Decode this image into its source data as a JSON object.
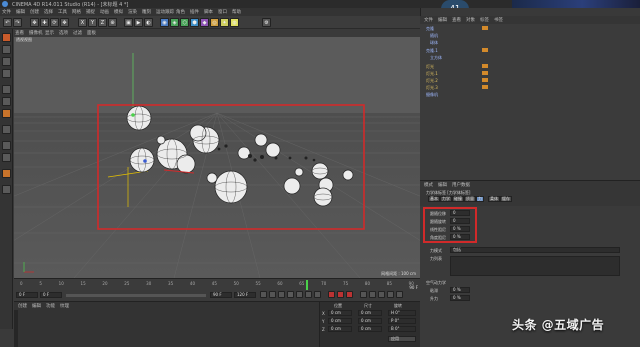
{
  "window": {
    "title": "CINEMA 4D R14.011 Studio (R14) - [未标题 4 *]",
    "top_badge": "41"
  },
  "menu": {
    "items": [
      "文件",
      "编辑",
      "创建",
      "选择",
      "工具",
      "网格",
      "捕捉",
      "动画",
      "模拟",
      "渲染",
      "雕刻",
      "运动跟踪",
      "角色",
      "插件",
      "脚本",
      "窗口",
      "帮助"
    ]
  },
  "toolbar": {
    "buttons": [
      "↶",
      "↷",
      "✥",
      "✚",
      "⟳",
      "✥",
      "X",
      "Y",
      "Z",
      "⊕",
      "▣",
      "▶",
      "◐",
      "◉",
      "◈",
      "⬡",
      "⬢",
      "◆",
      "◎",
      "✦",
      "◍",
      "⚙"
    ]
  },
  "viewport": {
    "menu_items": [
      "查看",
      "摄像机",
      "显示",
      "选项",
      "过滤",
      "面板"
    ],
    "tab_label": "透视视图",
    "grid_label": "网格间距 : 100 cm",
    "accent_red": "#d12a2a",
    "bg": "#5b5b5b"
  },
  "timeline": {
    "ticks": [
      "0",
      "5",
      "10",
      "15",
      "20",
      "25",
      "30",
      "35",
      "40",
      "45",
      "50",
      "55",
      "60",
      "65",
      "70",
      "75",
      "80",
      "85",
      "90"
    ],
    "end_frame": "90 F"
  },
  "playbar": {
    "start": "0 F",
    "current": "0 F",
    "end": "90 F",
    "end2": "120 F"
  },
  "materials": {
    "menu": [
      "创建",
      "编辑",
      "功能",
      "纹理"
    ]
  },
  "coords": {
    "headers": [
      "位置",
      "尺寸",
      "旋转"
    ],
    "rows": [
      {
        "axis": "X",
        "pos": "0 cm",
        "size": "0 cm",
        "rot": "H  0°"
      },
      {
        "axis": "Y",
        "pos": "0 cm",
        "size": "0 cm",
        "rot": "P  0°"
      },
      {
        "axis": "Z",
        "pos": "0 cm",
        "size": "0 cm",
        "rot": "B  0°"
      }
    ],
    "apply": "应用"
  },
  "objects": {
    "header": [
      "文件",
      "编辑",
      "查看",
      "对象",
      "标签",
      "书签"
    ],
    "rows": [
      "克隆",
      "随机",
      "球体",
      "克隆.1",
      "立方体",
      "灯光",
      "灯光.1",
      "灯光.2",
      "灯光.3",
      "摄像机"
    ]
  },
  "attributes": {
    "header": [
      "模式",
      "编辑",
      "用户数据"
    ],
    "title": "力学体标签 [力学体标签]",
    "tabs": [
      "基本",
      "力学",
      "碰撞",
      "质量",
      "力",
      "柔体",
      "缓存"
    ],
    "active_tab": "力",
    "fields": [
      {
        "label": "跟随位移",
        "value": "0"
      },
      {
        "label": "跟随旋转",
        "value": "0"
      },
      {
        "label": "线性阻尼",
        "value": "0 %"
      },
      {
        "label": "角度阻尼",
        "value": "0 %"
      }
    ],
    "force_mode_label": "力模式",
    "force_mode_value": "包括",
    "force_list_label": "力列表",
    "aero_header": "空气动力学",
    "aero_fields": [
      {
        "label": "粘滞",
        "value": "0 %"
      },
      {
        "label": "升力",
        "value": "0 %"
      }
    ]
  },
  "watermark": {
    "text": "头条 @五域广告"
  }
}
